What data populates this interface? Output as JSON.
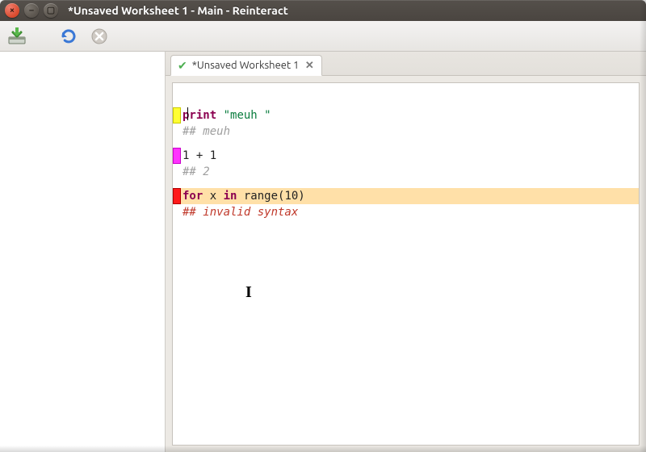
{
  "window": {
    "title": "*Unsaved Worksheet 1 - Main - Reinteract",
    "close_glyph": "×",
    "min_glyph": "–",
    "max_glyph": "▢"
  },
  "toolbar": {
    "save_title": "Save",
    "refresh_title": "Reload",
    "stop_title": "Stop"
  },
  "tab": {
    "label": "*Unsaved Worksheet 1",
    "check_glyph": "✔",
    "close_glyph": "✕"
  },
  "code": {
    "b1g_color": "yellow",
    "b1_kw": "print",
    "b1_space": " ",
    "b1_str": "\"meuh \"",
    "b1_out": "## meuh",
    "b2g_color": "magenta",
    "b2_expr": "1 + 1",
    "b2_out": "## 2",
    "b3g_color": "red",
    "b3_kw1": "for",
    "b3_mid": " x ",
    "b3_kw2": "in",
    "b3_rest": " range(10)",
    "b3_out": "## invalid syntax"
  },
  "cursor_glyph": "I"
}
